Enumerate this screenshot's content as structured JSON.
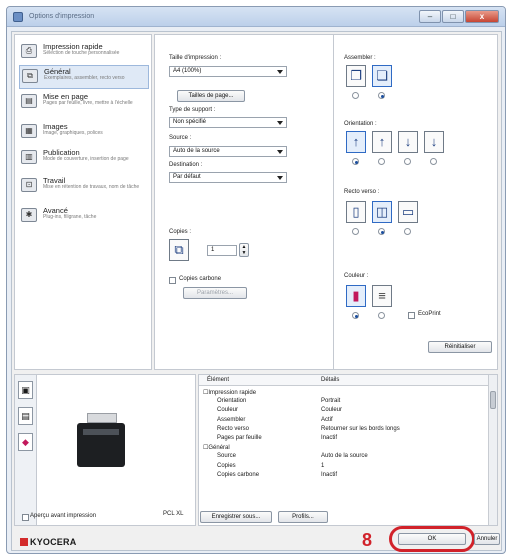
{
  "window": {
    "title": "Options d'impression",
    "minimize": "–",
    "maximize": "□",
    "close": "x"
  },
  "nav": [
    {
      "label": "Impression rapide",
      "sub": "Sélection de touche personnalisée",
      "icon": "printer-icon",
      "glyph": "⎙"
    },
    {
      "label": "Général",
      "sub": "Exemplaires, assembler, recto verso",
      "icon": "copies-icon",
      "glyph": "⧉"
    },
    {
      "label": "Mise en page",
      "sub": "Pages par feuille, livre, mettre à l'échelle",
      "icon": "layout-icon",
      "glyph": "▤"
    },
    {
      "label": "Images",
      "sub": "Image, graphiques, polices",
      "icon": "image-icon",
      "glyph": "▦"
    },
    {
      "label": "Publication",
      "sub": "Mode de couverture, insertion de page",
      "icon": "publication-icon",
      "glyph": "▥"
    },
    {
      "label": "Travail",
      "sub": "Mise en rétention de travaux, nom de tâche",
      "icon": "job-icon",
      "glyph": "⊡"
    },
    {
      "label": "Avancé",
      "sub": "Plug-ins, filigrane, tâche",
      "icon": "advanced-icon",
      "glyph": "✱"
    }
  ],
  "settings": {
    "print_size_label": "Taille d'impression :",
    "print_size_value": "A4 (100%)",
    "page_sizes_button": "Tailles de page...",
    "media_type_label": "Type de support :",
    "media_type_value": "Non spécifié",
    "source_label": "Source :",
    "source_value": "Auto de la source",
    "destination_label": "Destination :",
    "destination_value": "Par défaut",
    "copies_label": "Copies :",
    "copies_value": "1",
    "carbon_label": "Copies carbone",
    "parameters_button": "Paramètres...",
    "collate_label": "Assembler :",
    "orientation_label": "Orientation :",
    "duplex_label": "Recto verso :",
    "color_label": "Couleur :",
    "ecoprint_label": "EcoPrint",
    "reset_button": "Réinitialiser"
  },
  "details": {
    "col_element": "Élément",
    "col_details": "Détails",
    "rows": [
      {
        "k": "☐Impression rapide",
        "v": "",
        "indent": 0
      },
      {
        "k": "Orientation",
        "v": "Portrait",
        "indent": 1
      },
      {
        "k": "Couleur",
        "v": "Couleur",
        "indent": 1
      },
      {
        "k": "Assembler",
        "v": "Actif",
        "indent": 1
      },
      {
        "k": "Recto verso",
        "v": "Retourner sur les bords longs",
        "indent": 1
      },
      {
        "k": "Pages par feuille",
        "v": "Inactif",
        "indent": 1
      },
      {
        "k": "☐Général",
        "v": "",
        "indent": 0
      },
      {
        "k": "Source",
        "v": "Auto de la source",
        "indent": 1
      },
      {
        "k": "Copies",
        "v": "1",
        "indent": 1
      },
      {
        "k": "Copies carbone",
        "v": "Inactif",
        "indent": 1
      }
    ]
  },
  "preview": {
    "model": "PCL XL"
  },
  "footer": {
    "preview_checkbox_label": "Aperçu avant impression",
    "save_as_button": "Enregistrer sous...",
    "profiles_button": "Profils...",
    "ok_button": "OK",
    "cancel_button": "Annuler",
    "brand": "KYOCERA",
    "step_number": "8"
  }
}
